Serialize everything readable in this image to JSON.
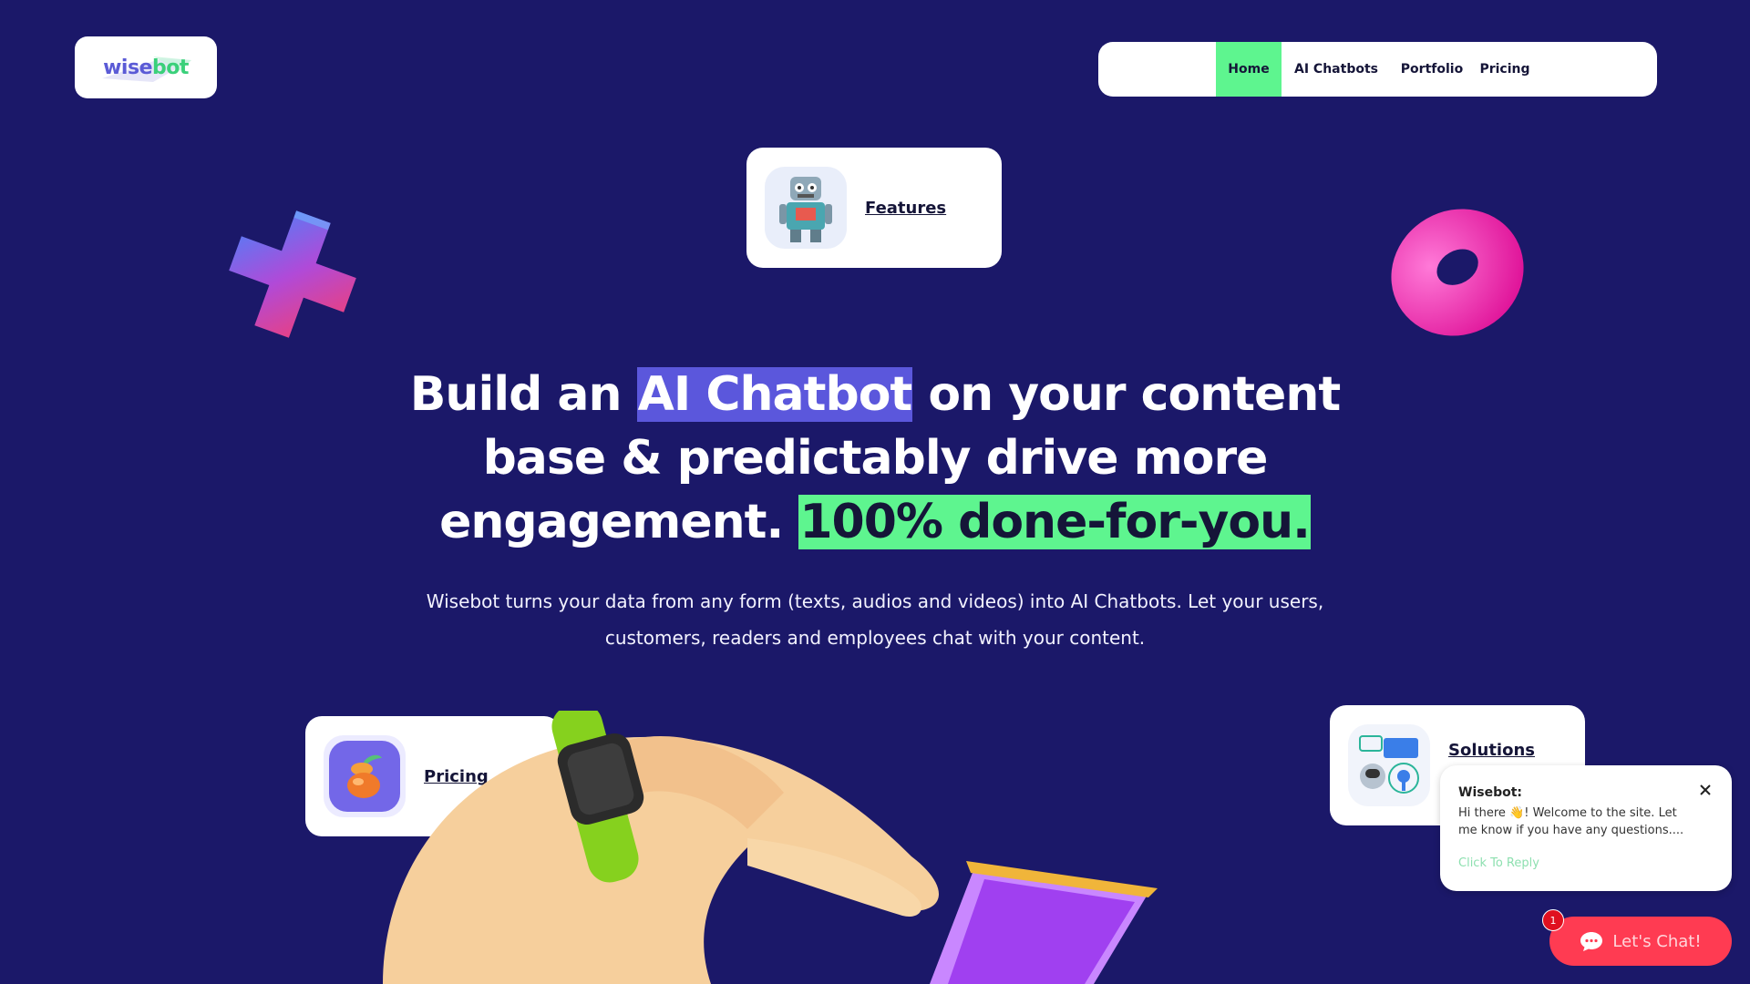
{
  "brand": {
    "logo_part1": "wise",
    "logo_part2": "bot",
    "accent_green": "#5ef58f",
    "accent_purple": "#5b57dc",
    "background": "#1b1869"
  },
  "nav": {
    "items": [
      {
        "label": "Home",
        "active": true
      },
      {
        "label": "AI Chatbots"
      },
      {
        "label": "Portfolio"
      },
      {
        "label": "Pricing"
      }
    ]
  },
  "cards": {
    "features": {
      "label": "Features",
      "icon": "robot-icon"
    },
    "pricing": {
      "label": "Pricing",
      "icon": "fruit-icon"
    },
    "solutions": {
      "label": "Solutions",
      "icon": "ideas-icon"
    }
  },
  "hero": {
    "title_before": "Build an ",
    "title_highlight1": "AI Chatbot",
    "title_middle": " on your content base & predictably drive more engagement. ",
    "title_highlight2": "100% done-for-you.",
    "subtitle": "Wisebot turns your data from any form (texts, audios and videos) into AI Chatbots. Let your users, customers, readers and employees chat with your content."
  },
  "chat": {
    "sender": "Wisebot:",
    "message": "Hi there 👋! Welcome to the site. Let me know if you have any questions....",
    "reply_label": "Click To Reply",
    "button_label": "Let's Chat!",
    "badge_count": "1"
  }
}
